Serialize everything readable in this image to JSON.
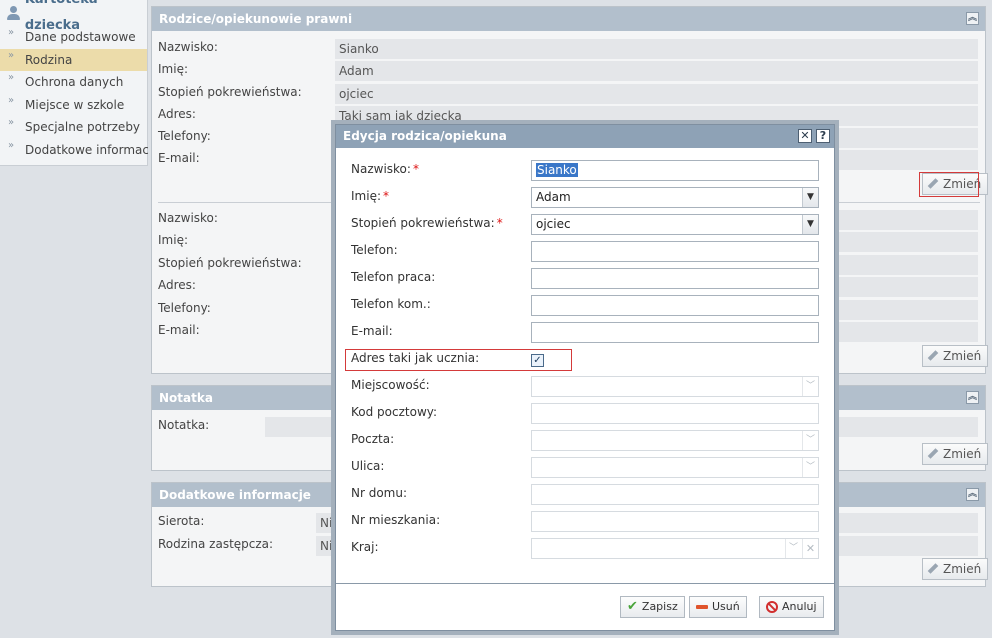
{
  "sidebar": {
    "title": "Kartoteka dziecka",
    "items": [
      {
        "label": "Dane podstawowe"
      },
      {
        "label": "Rodzina"
      },
      {
        "label": "Ochrona danych"
      },
      {
        "label": "Miejsce w szkole"
      },
      {
        "label": "Specjalne potrzeby"
      },
      {
        "label": "Dodatkowe informacje"
      }
    ]
  },
  "parents_panel": {
    "title": "Rodzice/opiekunowie prawni",
    "parent1": {
      "labels": [
        "Nazwisko:",
        "Imię:",
        "Stopień pokrewieństwa:",
        "Adres:",
        "Telefony:",
        "E-mail:"
      ],
      "values": [
        "Sianko",
        "Adam",
        "ojciec",
        "Taki sam jak dziecka",
        "",
        ""
      ]
    },
    "parent2": {
      "labels": [
        "Nazwisko:",
        "Imię:",
        "Stopień pokrewieństwa:",
        "Adres:",
        "Telefony:",
        "E-mail:"
      ]
    },
    "change_label": "Zmień"
  },
  "note_panel": {
    "title": "Notatka",
    "label": "Notatka:",
    "change_label": "Zmień"
  },
  "extra_panel": {
    "title": "Dodatkowe informacje",
    "labels": [
      "Sierota:",
      "Rodzina zastępcza:"
    ],
    "values": [
      "Nie",
      "Nie"
    ],
    "change_label": "Zmień"
  },
  "dialog": {
    "title": "Edycja rodzica/opiekuna",
    "close_glyph": "✕",
    "help_glyph": "?",
    "required_mark": "*",
    "fields": {
      "surname": {
        "label": "Nazwisko:",
        "value": "Sianko"
      },
      "first_name": {
        "label": "Imię:",
        "value": "Adam"
      },
      "relation": {
        "label": "Stopień pokrewieństwa:",
        "value": "ojciec"
      },
      "phone": {
        "label": "Telefon:",
        "value": ""
      },
      "work_phone": {
        "label": "Telefon praca:",
        "value": ""
      },
      "mobile_phone": {
        "label": "Telefon kom.:",
        "value": ""
      },
      "email": {
        "label": "E-mail:",
        "value": ""
      },
      "same_address": {
        "label": "Adres taki jak ucznia:",
        "checked": true
      },
      "city": {
        "label": "Miejscowość:",
        "value": ""
      },
      "postal_code": {
        "label": "Kod pocztowy:",
        "value": ""
      },
      "post_office": {
        "label": "Poczta:",
        "value": ""
      },
      "street": {
        "label": "Ulica:",
        "value": ""
      },
      "house_no": {
        "label": "Nr domu:",
        "value": ""
      },
      "apartment_no": {
        "label": "Nr mieszkania:",
        "value": ""
      },
      "country": {
        "label": "Kraj:",
        "value": ""
      }
    },
    "buttons": {
      "save": "Zapisz",
      "delete": "Usuń",
      "cancel": "Anuluj"
    }
  },
  "colors": {
    "highlight_box": "#d43a3a",
    "panel_header": "#b2bfcc",
    "dialog_header": "#8ea2b6",
    "active_sidebar": "#ecdcaa"
  }
}
